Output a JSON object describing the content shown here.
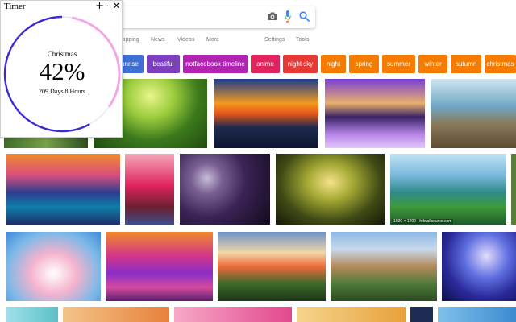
{
  "search": {
    "query": ""
  },
  "nav": {
    "items": [
      "Shopping",
      "News",
      "Videos",
      "More"
    ],
    "settings": "Settings",
    "tools": "Tools"
  },
  "chips": [
    {
      "label": "sunrise",
      "color": "#3f6fd2"
    },
    {
      "label": "beatiful",
      "color": "#7b3fbf"
    },
    {
      "label": "notfacebook timeline",
      "color": "#b124b1"
    },
    {
      "label": "anime",
      "color": "#e0245e"
    },
    {
      "label": "night sky",
      "color": "#e53935"
    },
    {
      "label": "night",
      "color": "#f57c00"
    },
    {
      "label": "spring",
      "color": "#f57c00"
    },
    {
      "label": "summer",
      "color": "#f57c00"
    },
    {
      "label": "winter",
      "color": "#f57c00"
    },
    {
      "label": "autumn",
      "color": "#f57c00"
    },
    {
      "label": "christmas",
      "color": "#f57c00"
    }
  ],
  "images": [
    {
      "caption": ""
    },
    {
      "caption": ""
    },
    {
      "caption": ""
    },
    {
      "caption": ""
    },
    {
      "caption": ""
    },
    {
      "caption": ""
    },
    {
      "caption": ""
    },
    {
      "caption": ""
    },
    {
      "caption": ""
    },
    {
      "caption": ""
    },
    {
      "caption": "1920 × 1200 - hdwallsource.com"
    },
    {
      "caption": ""
    },
    {
      "caption": ""
    },
    {
      "caption": ""
    },
    {
      "caption": ""
    },
    {
      "caption": ""
    },
    {
      "caption": ""
    },
    {
      "caption": ""
    }
  ],
  "timer": {
    "title": "Timer",
    "add": "+",
    "minimize": "-",
    "close": "×",
    "event": "Christmas",
    "percent": "42%",
    "percent_value": 0.42,
    "remaining": "209 Days 8 Hours",
    "colors": {
      "progress": "#3b2bd0",
      "remaining": "#f2a8e4",
      "track": "#e4e4e4"
    }
  }
}
